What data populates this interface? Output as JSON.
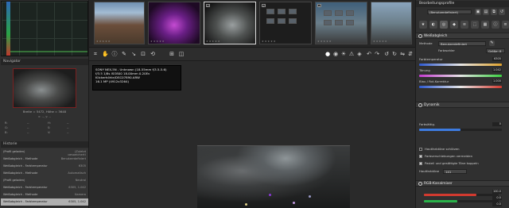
{
  "left_panel": {
    "navigator_title": "Navigator",
    "navigator_info": "Breite = 5472, Höhe = 3648",
    "navigator_sub": "x: --, y: --",
    "readout_rows": [
      {
        "a": "R:",
        "b": "--",
        "c": "H:",
        "d": "--"
      },
      {
        "a": "G:",
        "b": "--",
        "c": "S:",
        "d": "--"
      },
      {
        "a": "B:",
        "b": "--",
        "c": "V:",
        "d": "--"
      }
    ],
    "history_title": "Historie",
    "history_rows": [
      {
        "label": "(Profil geladen)",
        "value": "(Zuletzt gespeichert)"
      },
      {
        "label": "Weißabgleich - Methode",
        "value": "Benutzerdefiniert"
      },
      {
        "label": "Weißabgleich - Farbtemperatur",
        "value": "6305"
      },
      {
        "label": "Weißabgleich - Methode",
        "value": "Automatisch"
      },
      {
        "label": "(Profil geladen)",
        "value": "Neutral"
      },
      {
        "label": "Weißabgleich - Farbtemperatur",
        "value": "6305, 1.042"
      },
      {
        "label": "Weißabgleich - Methode",
        "value": "Kamera"
      },
      {
        "label": "Weißabgleich - Farbtemperatur",
        "value": "6305, 1.042"
      }
    ]
  },
  "filmstrip": {
    "stars": "★★★★★"
  },
  "toolbar": {
    "icons": [
      "crop-icon",
      "hand-icon",
      "info-icon",
      "color-picker-icon",
      "straighten-icon",
      "crop-icon-2",
      "rotate-icon",
      "grid-icon",
      "before-after-icon",
      "red-channel-icon",
      "green-channel-icon",
      "blue-channel-icon",
      "luminance-icon",
      "focus-mask-icon",
      "undo-icon",
      "redo-icon",
      "rotate-left-icon",
      "rotate-right-icon",
      "flip-horizontal-icon",
      "flip-vertical-icon"
    ]
  },
  "exif": {
    "camera": "SONY NEX-5N  -  Unknown (18-55mm f/3.5-5.6)",
    "shooting": "f/3.5   1/8s   ISO800   18.00mm   0.20Ev",
    "filename": "Klickerhöhle/DSC07890.ARW",
    "size": "16.1 MP  (4912x3264)"
  },
  "right_panel": {
    "profile_title": "Bearbeitungsprofile",
    "profile_value": "(Benutzerdefiniert)",
    "wb_title": "Weißabgleich",
    "method_label": "Methode",
    "method_value": "Benutzerdefiniert",
    "fill_label": "Farbwahler",
    "fill_value": "Größe: 8",
    "temp_label": "Farbtemperatur",
    "temp_value": "6305",
    "tint_label": "Tönung",
    "tint_value": "1.042",
    "blue_red_label": "Blau / Rot-Korrektur",
    "blue_red_value": "1.000",
    "dynamics_title": "Dynamik",
    "dynamics_value_label": "Farbsättig.",
    "dyn_slider_value": "0",
    "cb1": "Hautfarbtöne schützen",
    "cb2": "Farbverschiebungen vermeiden",
    "cb3": "Pastell und gesättigte Töne koppeln",
    "hautfarben_label": "Hautfarbtöne",
    "hautfarben_value": "141",
    "rgb_title": "RGB-Kanalmixer",
    "rgb_v1": "100.0",
    "rgb_v2": "0.0",
    "rgb_v3": "0.0",
    "colors": {
      "accent": "#3d7be0",
      "red": "#d23a2f",
      "green": "#2ab24a"
    }
  }
}
